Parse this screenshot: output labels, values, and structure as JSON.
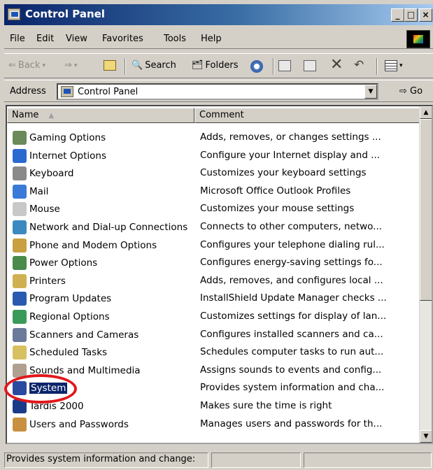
{
  "window": {
    "title": "Control Panel"
  },
  "title_buttons": {
    "minimize": "_",
    "maximize": "□",
    "close": "×"
  },
  "menu": [
    "File",
    "Edit",
    "View",
    "Favorites",
    "Tools",
    "Help"
  ],
  "toolbar": {
    "back": "Back",
    "search": "Search",
    "folders": "Folders"
  },
  "address": {
    "label": "Address",
    "value": "Control Panel",
    "go": "Go"
  },
  "columns": {
    "name": "Name",
    "comment": "Comment"
  },
  "items": [
    {
      "name": "Gaming Options",
      "comment": "Adds, removes, or changes settings ...",
      "icon": "gaming-options-icon",
      "color": "#6a8a5a"
    },
    {
      "name": "Internet Options",
      "comment": "Configure your Internet display and ...",
      "icon": "internet-options-icon",
      "color": "#2a6ad0"
    },
    {
      "name": "Keyboard",
      "comment": "Customizes your keyboard settings",
      "icon": "keyboard-icon",
      "color": "#8a8a8a"
    },
    {
      "name": "Mail",
      "comment": "Microsoft Office Outlook Profiles",
      "icon": "mail-icon",
      "color": "#3a7ad8"
    },
    {
      "name": "Mouse",
      "comment": "Customizes your mouse settings",
      "icon": "mouse-icon",
      "color": "#c8c8c8"
    },
    {
      "name": "Network and Dial-up Connections",
      "comment": "Connects to other computers, netwo...",
      "icon": "network-icon",
      "color": "#3a8ac0"
    },
    {
      "name": "Phone and Modem Options",
      "comment": "Configures your telephone dialing rul...",
      "icon": "phone-modem-icon",
      "color": "#c8a040"
    },
    {
      "name": "Power Options",
      "comment": "Configures energy-saving settings fo...",
      "icon": "power-options-icon",
      "color": "#4a8a4a"
    },
    {
      "name": "Printers",
      "comment": "Adds, removes, and configures local ...",
      "icon": "printers-icon",
      "color": "#d0b050"
    },
    {
      "name": "Program Updates",
      "comment": "InstallShield Update Manager checks ...",
      "icon": "program-updates-icon",
      "color": "#2a5ab0"
    },
    {
      "name": "Regional Options",
      "comment": "Customizes settings for display of lan...",
      "icon": "regional-options-icon",
      "color": "#3a9a5a"
    },
    {
      "name": "Scanners and Cameras",
      "comment": "Configures installed scanners and ca...",
      "icon": "scanners-cameras-icon",
      "color": "#6a7a9a"
    },
    {
      "name": "Scheduled Tasks",
      "comment": "Schedules computer tasks to run aut...",
      "icon": "scheduled-tasks-icon",
      "color": "#d8c060"
    },
    {
      "name": "Sounds and Multimedia",
      "comment": "Assigns sounds to events and config...",
      "icon": "sounds-multimedia-icon",
      "color": "#b0a090"
    },
    {
      "name": "System",
      "comment": "Provides system information and cha...",
      "icon": "system-icon",
      "color": "#2a4aa0",
      "selected": true
    },
    {
      "name": "Tardis 2000",
      "comment": "Makes sure the time is right",
      "icon": "tardis-icon",
      "color": "#1a3a8a"
    },
    {
      "name": "Users and Passwords",
      "comment": "Manages users and passwords for th...",
      "icon": "users-passwords-icon",
      "color": "#c89040"
    }
  ],
  "status": {
    "text": "Provides system information and change:"
  },
  "colors": {
    "title_start": "#0a246a",
    "title_end": "#a6caf0",
    "selection": "#0a246a",
    "annotation": "#e0181c",
    "chrome": "#d4d0c8"
  }
}
